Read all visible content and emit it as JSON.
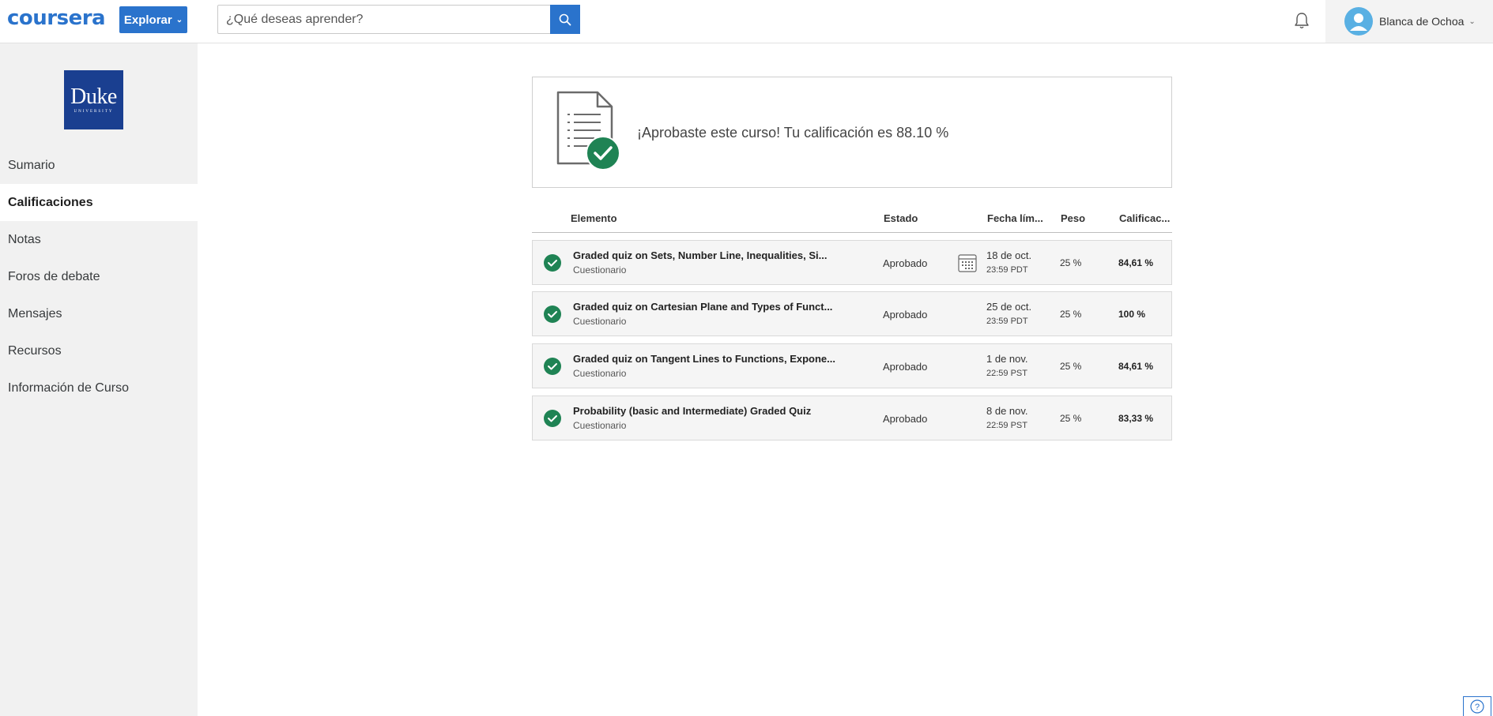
{
  "header": {
    "logo": "coursera",
    "explore_label": "Explorar",
    "search_placeholder": "¿Qué deseas aprender?",
    "user_name": "Blanca de Ochoa"
  },
  "sidebar": {
    "university_logo_text": "Duke",
    "university_logo_sub": "UNIVERSITY",
    "items": [
      {
        "label": "Sumario"
      },
      {
        "label": "Calificaciones",
        "active": true
      },
      {
        "label": "Notas"
      },
      {
        "label": "Foros de debate"
      },
      {
        "label": "Mensajes"
      },
      {
        "label": "Recursos"
      },
      {
        "label": "Información de Curso"
      }
    ]
  },
  "banner": {
    "text": "¡Aprobaste este curso! Tu calificación es 88.10 %"
  },
  "table": {
    "headers": {
      "element": "Elemento",
      "status": "Estado",
      "due": "Fecha lím...",
      "weight": "Peso",
      "grade": "Calificac..."
    },
    "rows": [
      {
        "title": "Graded quiz on Sets, Number Line, Inequalities, Si...",
        "type": "Cuestionario",
        "status": "Aprobado",
        "date": "18 de oct.",
        "time": "23:59 PDT",
        "weight": "25 %",
        "grade": "84,61 %",
        "has_calendar": true
      },
      {
        "title": "Graded quiz on Cartesian Plane and Types of Funct...",
        "type": "Cuestionario",
        "status": "Aprobado",
        "date": "25 de oct.",
        "time": "23:59 PDT",
        "weight": "25 %",
        "grade": "100 %",
        "has_calendar": false
      },
      {
        "title": "Graded quiz on Tangent Lines to Functions, Expone...",
        "type": "Cuestionario",
        "status": "Aprobado",
        "date": "1 de nov.",
        "time": "22:59 PST",
        "weight": "25 %",
        "grade": "84,61 %",
        "has_calendar": false
      },
      {
        "title": "Probability (basic and Intermediate) Graded Quiz",
        "type": "Cuestionario",
        "status": "Aprobado",
        "date": "8 de nov.",
        "time": "22:59 PST",
        "weight": "25 %",
        "grade": "83,33 %",
        "has_calendar": false
      }
    ]
  },
  "colors": {
    "brand": "#2a73cc",
    "success": "#1f8354",
    "sidebar_bg": "#f1f1f1",
    "duke_blue": "#1a3f90"
  },
  "icons": [
    "search-icon",
    "bell-icon",
    "avatar-icon",
    "document-check-icon",
    "check-circle-icon",
    "calendar-icon",
    "help-icon"
  ]
}
